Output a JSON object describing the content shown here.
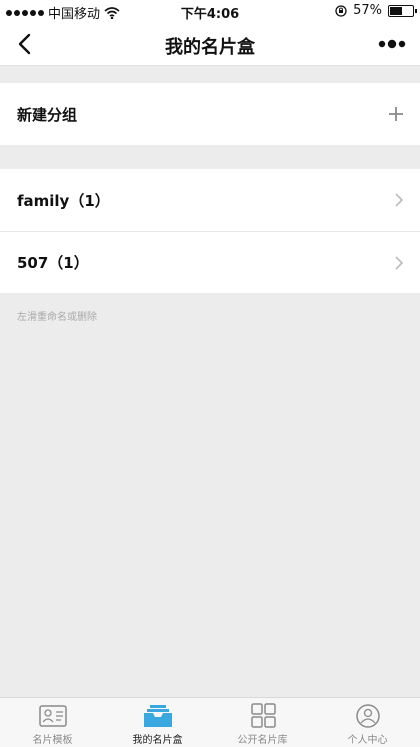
{
  "status": {
    "carrier": "中国移动",
    "time": "下午4:06",
    "battery": "57%",
    "battery_level": 0.57
  },
  "nav": {
    "title": "我的名片盒"
  },
  "new_group": {
    "label": "新建分组"
  },
  "groups": [
    {
      "label": "family（1）"
    },
    {
      "label": "507（1）"
    }
  ],
  "hint": "左滑重命名或删除",
  "tabs": [
    {
      "label": "名片模板",
      "icon": "card-template-icon",
      "active": false
    },
    {
      "label": "我的名片盒",
      "icon": "card-box-icon",
      "active": true
    },
    {
      "label": "公开名片库",
      "icon": "grid-icon",
      "active": false
    },
    {
      "label": "个人中心",
      "icon": "user-icon",
      "active": false
    }
  ],
  "colors": {
    "accent": "#3aa8e0",
    "background": "#ececec"
  }
}
